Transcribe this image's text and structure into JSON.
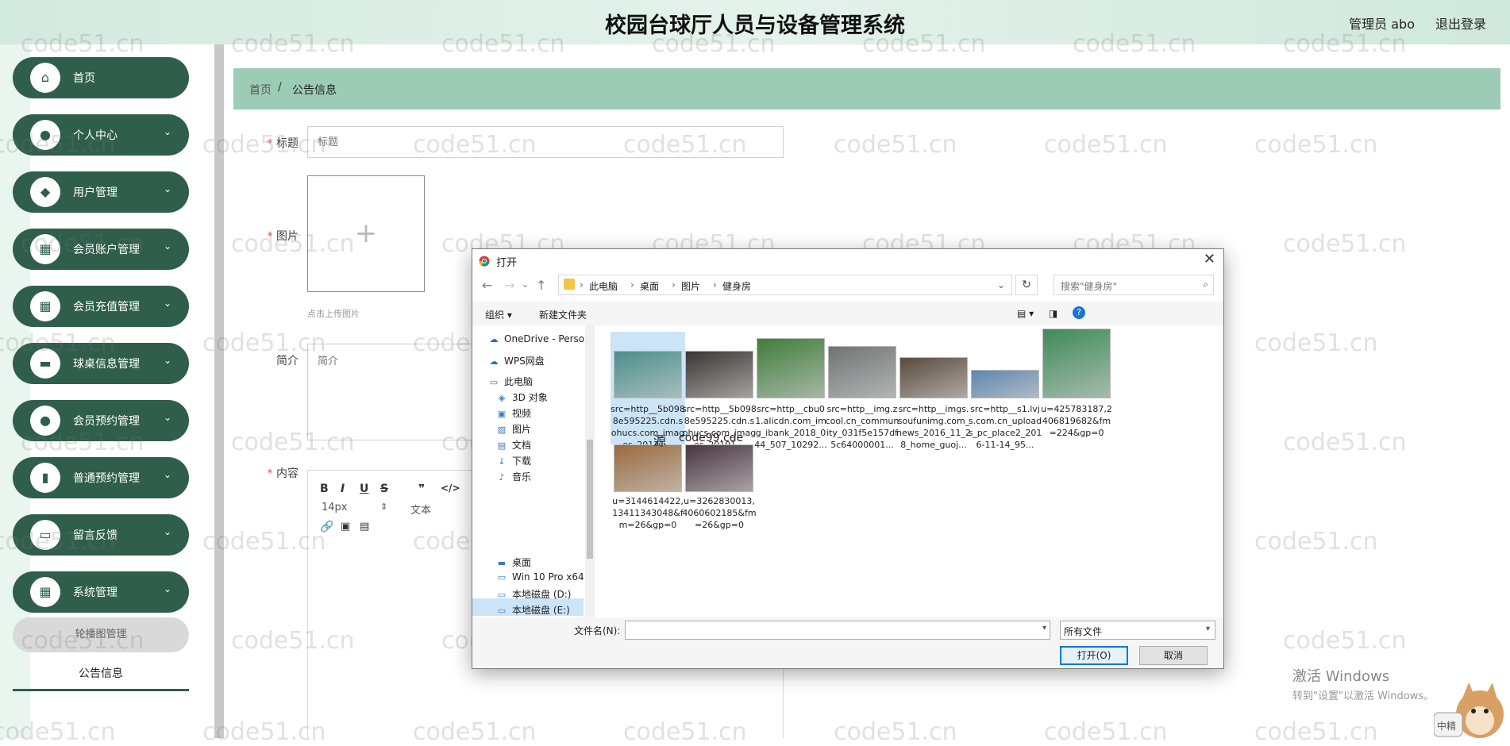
{
  "header": {
    "title": "校园台球厅人员与设备管理系统",
    "user": "管理员 abo",
    "logout": "退出登录"
  },
  "sidebar": {
    "items": [
      {
        "label": "首页",
        "icon": "home-icon",
        "chevron": false
      },
      {
        "label": "个人中心",
        "icon": "user-icon",
        "chevron": true
      },
      {
        "label": "用户管理",
        "icon": "user-manage-icon",
        "chevron": true
      },
      {
        "label": "会员账户管理",
        "icon": "grid-icon",
        "chevron": true
      },
      {
        "label": "会员充值管理",
        "icon": "grid-icon",
        "chevron": true
      },
      {
        "label": "球桌信息管理",
        "icon": "chat-icon",
        "chevron": true
      },
      {
        "label": "会员预约管理",
        "icon": "bulb-icon",
        "chevron": true
      },
      {
        "label": "普通预约管理",
        "icon": "clipboard-icon",
        "chevron": true
      },
      {
        "label": "留言反馈",
        "icon": "monitor-icon",
        "chevron": true
      },
      {
        "label": "系统管理",
        "icon": "grid-icon",
        "chevron": true
      }
    ],
    "sub_items": [
      "轮播图管理",
      "公告信息"
    ]
  },
  "breadcrumb": {
    "home": "首页",
    "sep": "/",
    "current": "公告信息"
  },
  "form": {
    "title_label": "标题",
    "title_placeholder": "标题",
    "image_label": "图片",
    "upload_hint": "点击上传图片",
    "intro_label": "简介",
    "intro_placeholder": "简介",
    "content_label": "内容",
    "editor": {
      "bold": "B",
      "italic": "I",
      "underline": "U",
      "strike": "S",
      "quote": "❞",
      "code": "</>",
      "font_size": "14px",
      "text_style": "文本"
    }
  },
  "dialog": {
    "title": "打开",
    "path": [
      "此电脑",
      "桌面",
      "图片",
      "健身房"
    ],
    "search_placeholder": "搜索\"健身房\"",
    "organize": "组织 ▾",
    "new_folder": "新建文件夹",
    "tree": [
      {
        "label": "OneDrive - Perso",
        "icon": "cloud-icon"
      },
      {
        "label": "WPS网盘",
        "icon": "cloud-icon"
      },
      {
        "label": "此电脑",
        "icon": "computer-icon"
      },
      {
        "label": "3D 对象",
        "icon": "cube-icon"
      },
      {
        "label": "视频",
        "icon": "video-icon"
      },
      {
        "label": "图片",
        "icon": "picture-icon"
      },
      {
        "label": "文档",
        "icon": "document-icon"
      },
      {
        "label": "下载",
        "icon": "download-icon"
      },
      {
        "label": "音乐",
        "icon": "music-icon"
      },
      {
        "label": "桌面",
        "icon": "desktop-icon"
      },
      {
        "label": "Win 10 Pro x64",
        "icon": "drive-icon"
      },
      {
        "label": "本地磁盘 (D:)",
        "icon": "drive-icon"
      },
      {
        "label": "本地磁盘 (E:)",
        "icon": "drive-icon"
      }
    ],
    "files": [
      {
        "name": "src=http__5b0988e595225.cdn.sohucs.com_images_20171...",
        "color": "#4a8f8c"
      },
      {
        "name": "src=http__5b0988e595225.cdn.sohucs.com_images_20191...",
        "color": "#3a3530"
      },
      {
        "name": "src=http__cbu01.alicdn.com_img_ibank_2018_044_507_10292...",
        "color": "#3f7d3a"
      },
      {
        "name": "src=http__img.zcool.cn_community_031f5e157df5c64000001...",
        "color": "#6f7473"
      },
      {
        "name": "src=http__imgs.soufunimg.com_news_2016_11_28_home_guoj...",
        "color": "#5a4a3c"
      },
      {
        "name": "src=http__s1.lvjs.com.cn_uploads_pc_place2_2016-11-14_95...",
        "color": "#5f86b0"
      },
      {
        "name": "u=425783187,2406819682&fm=224&gp=0",
        "color": "#3e8a58"
      },
      {
        "name": "u=3144614422,13411343048&fm=26&gp=0",
        "color": "#9a6a3c"
      },
      {
        "name": "u=3262830013,4060602185&fm=26&gp=0",
        "color": "#4a3440"
      }
    ],
    "filename_label": "文件名(N):",
    "filetype": "所有文件",
    "open": "打开(O)",
    "cancel": "取消",
    "overlay_text": "源",
    "overlay_text2": "code99.cde"
  },
  "watermark": "code51.cn",
  "windows": {
    "line1": "激活 Windows",
    "line2": "转到\"设置\"以激活 Windows。"
  },
  "dog_label": "中精",
  "colors": {
    "sidebar_green": "#2f5f4b",
    "breadcrumb_green": "#9cccb6",
    "header_green": "#d3eadf"
  }
}
